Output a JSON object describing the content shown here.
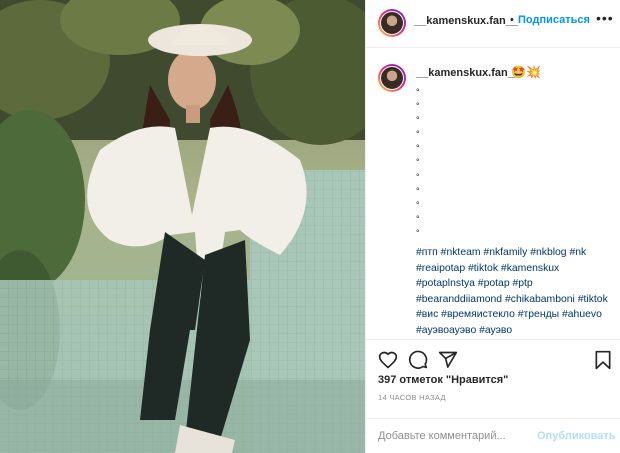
{
  "post": {
    "username": "__kamenskux.fan__",
    "follow_label": "Подписаться",
    "separator": "•",
    "more": "•••"
  },
  "caption": {
    "username": "__kamenskux.fan__",
    "emojis": "🤩💥",
    "dot_lines": [
      "°",
      "°",
      "°",
      "°",
      "°",
      "°",
      "°",
      "°",
      "°",
      "°",
      "°"
    ],
    "hashtags": "#птп #nkteam #nkfamily #nkblog #nk #reaipotap #tiktok #kamenskux #potaplnstya #potap #ptp #bearanddiiamond #chikabamboni #tiktok #вис #времяистекло #тренды #ahuevo #ауэвоауэво #ауэво"
  },
  "stats": {
    "likes": "397 отметок \"Нравится\"",
    "time": "14 ЧАСОВ НАЗАД"
  },
  "comment": {
    "placeholder": "Добавьте комментарий...",
    "publish": "Опубликовать"
  },
  "colors": {
    "link": "#00376b",
    "accent": "#0095f6",
    "muted": "#8e8e8e"
  },
  "icons": [
    "heart-icon",
    "comment-icon",
    "share-icon",
    "bookmark-icon",
    "more-icon"
  ]
}
